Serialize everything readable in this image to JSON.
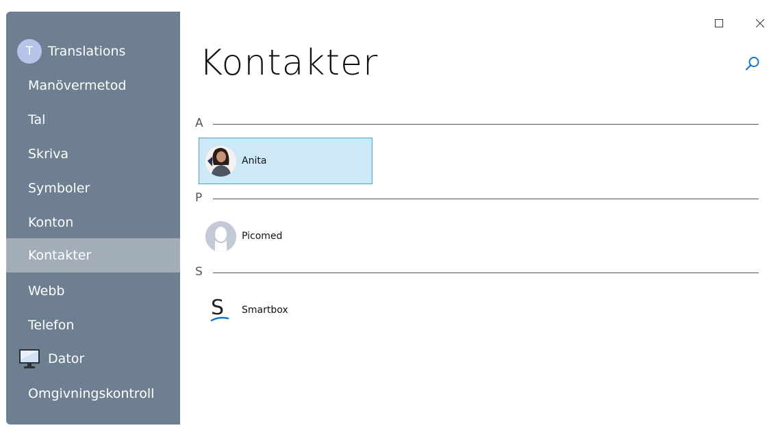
{
  "sidebar": {
    "items": [
      {
        "label": "Translations",
        "icon": "avatar-letter",
        "avatar_letter": "T"
      },
      {
        "label": "Manövermetod"
      },
      {
        "label": "Tal"
      },
      {
        "label": "Skriva"
      },
      {
        "label": "Symboler"
      },
      {
        "label": "Konton"
      },
      {
        "label": "Kontakter",
        "selected": true
      },
      {
        "label": "Webb"
      },
      {
        "label": "Telefon"
      },
      {
        "label": "Dator",
        "icon": "monitor-icon"
      },
      {
        "label": "Omgivningskontroll"
      }
    ]
  },
  "window_controls": {
    "maximize_icon": "maximize-icon",
    "close_icon": "close-icon"
  },
  "header": {
    "title": "Kontakter",
    "search_icon": "search-icon"
  },
  "groups": [
    {
      "letter": "A",
      "contacts": [
        {
          "name": "Anita",
          "avatar": "photo",
          "selected": true
        }
      ]
    },
    {
      "letter": "P",
      "contacts": [
        {
          "name": "Picomed",
          "avatar": "placeholder-person"
        }
      ]
    },
    {
      "letter": "S",
      "contacts": [
        {
          "name": "Smartbox",
          "avatar": "smartbox-logo",
          "logo_letter": "S"
        }
      ]
    }
  ],
  "colors": {
    "sidebar_bg": "#6e7f91",
    "sidebar_selected": "#a2adb8",
    "contact_selected_bg": "#cde8f6",
    "contact_selected_border": "#4aa3dc",
    "accent": "#1a73c8"
  }
}
